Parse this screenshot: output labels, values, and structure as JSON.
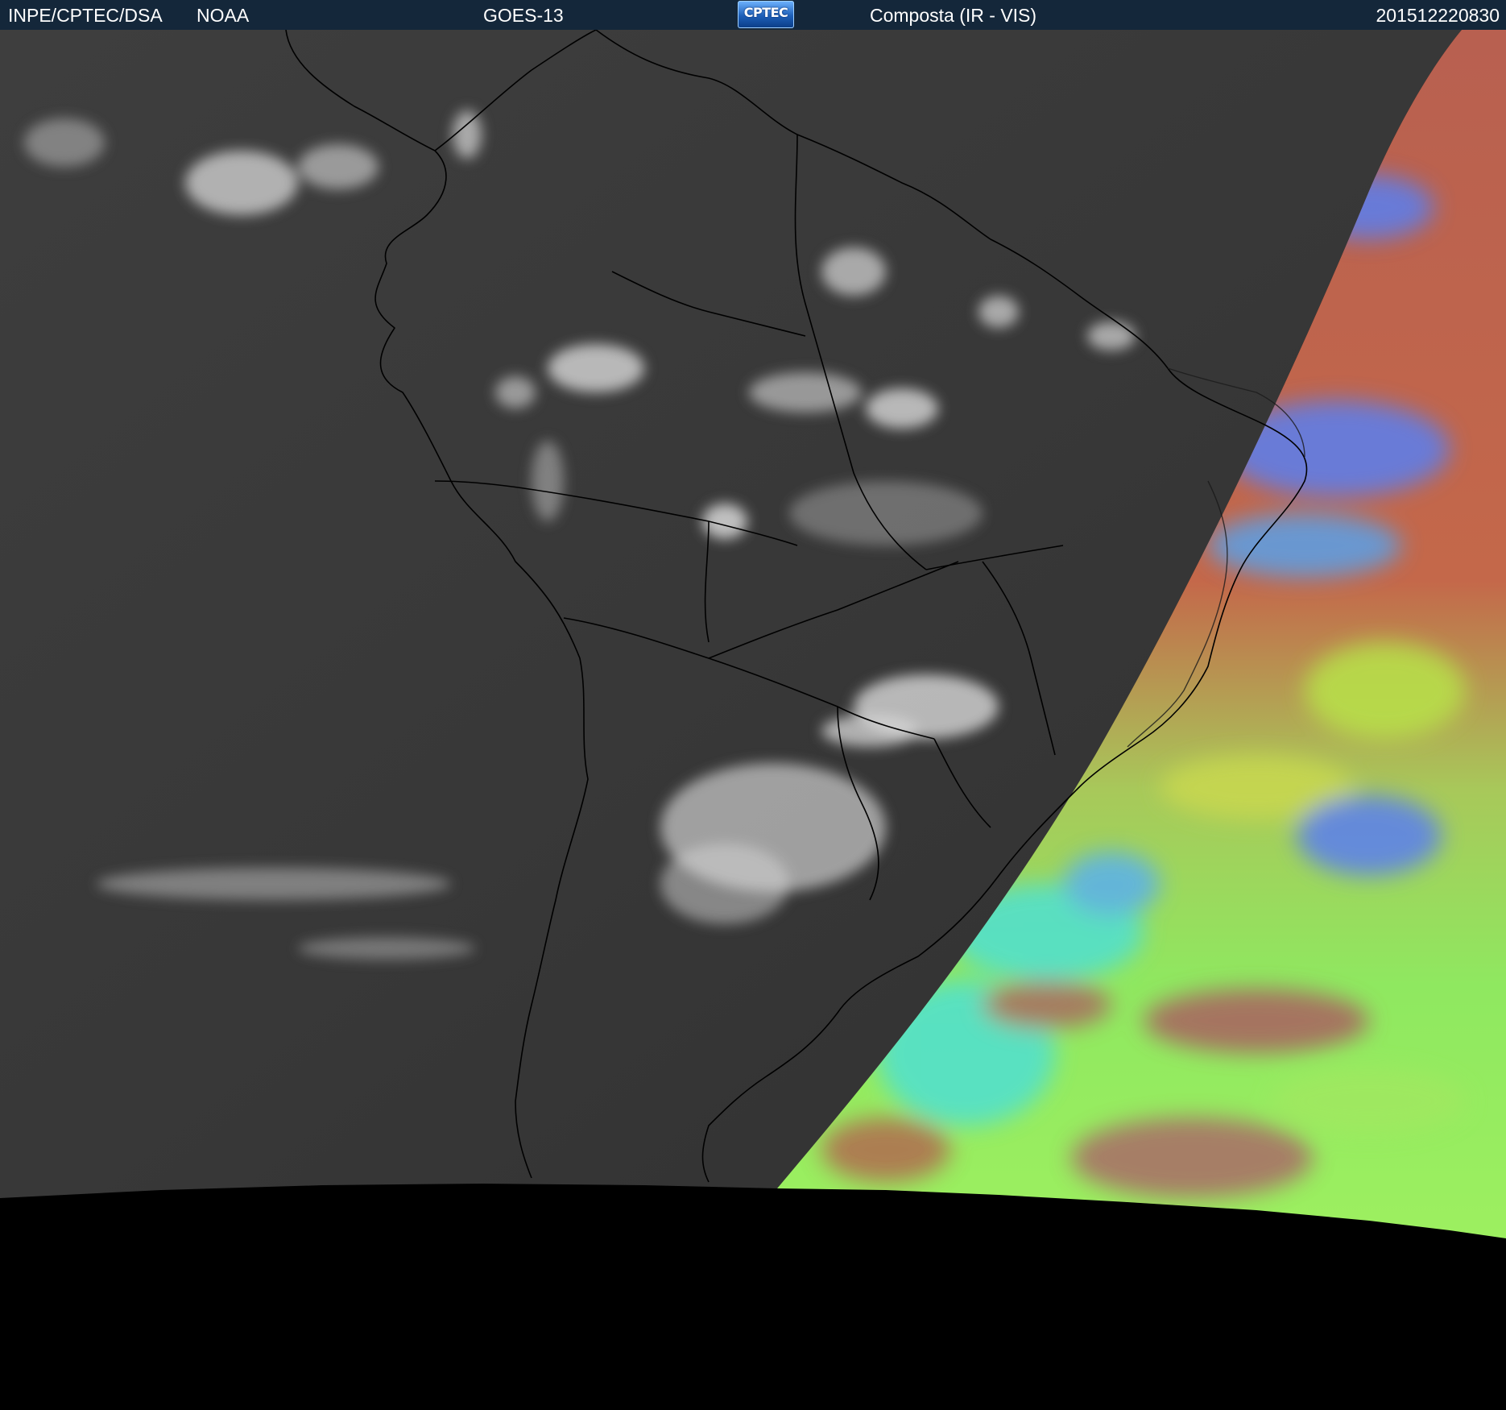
{
  "header": {
    "agency": "INPE/CPTEC/DSA",
    "partner": "NOAA",
    "satellite": "GOES-13",
    "logo_text": "CPTEC",
    "product": "Composta (IR - VIS)",
    "timestamp": "201512220830"
  },
  "colors": {
    "header_background": "#14273a",
    "header_text": "#ffffff",
    "background": "#000000",
    "ir_ocean": "#3a3a3a",
    "cloud_tops": "#d8d8d8",
    "coastline_borders": "#000000",
    "vis_red": "#c0634a",
    "vis_green": "#9aef5a",
    "vis_cyan": "#4fe0d2",
    "vis_blue": "#5a7ff0"
  },
  "map": {
    "projection_view": "South America satellite disk (GOES-13)",
    "left_panel": "infrared grayscale",
    "right_panel": "visible false-color composite"
  }
}
